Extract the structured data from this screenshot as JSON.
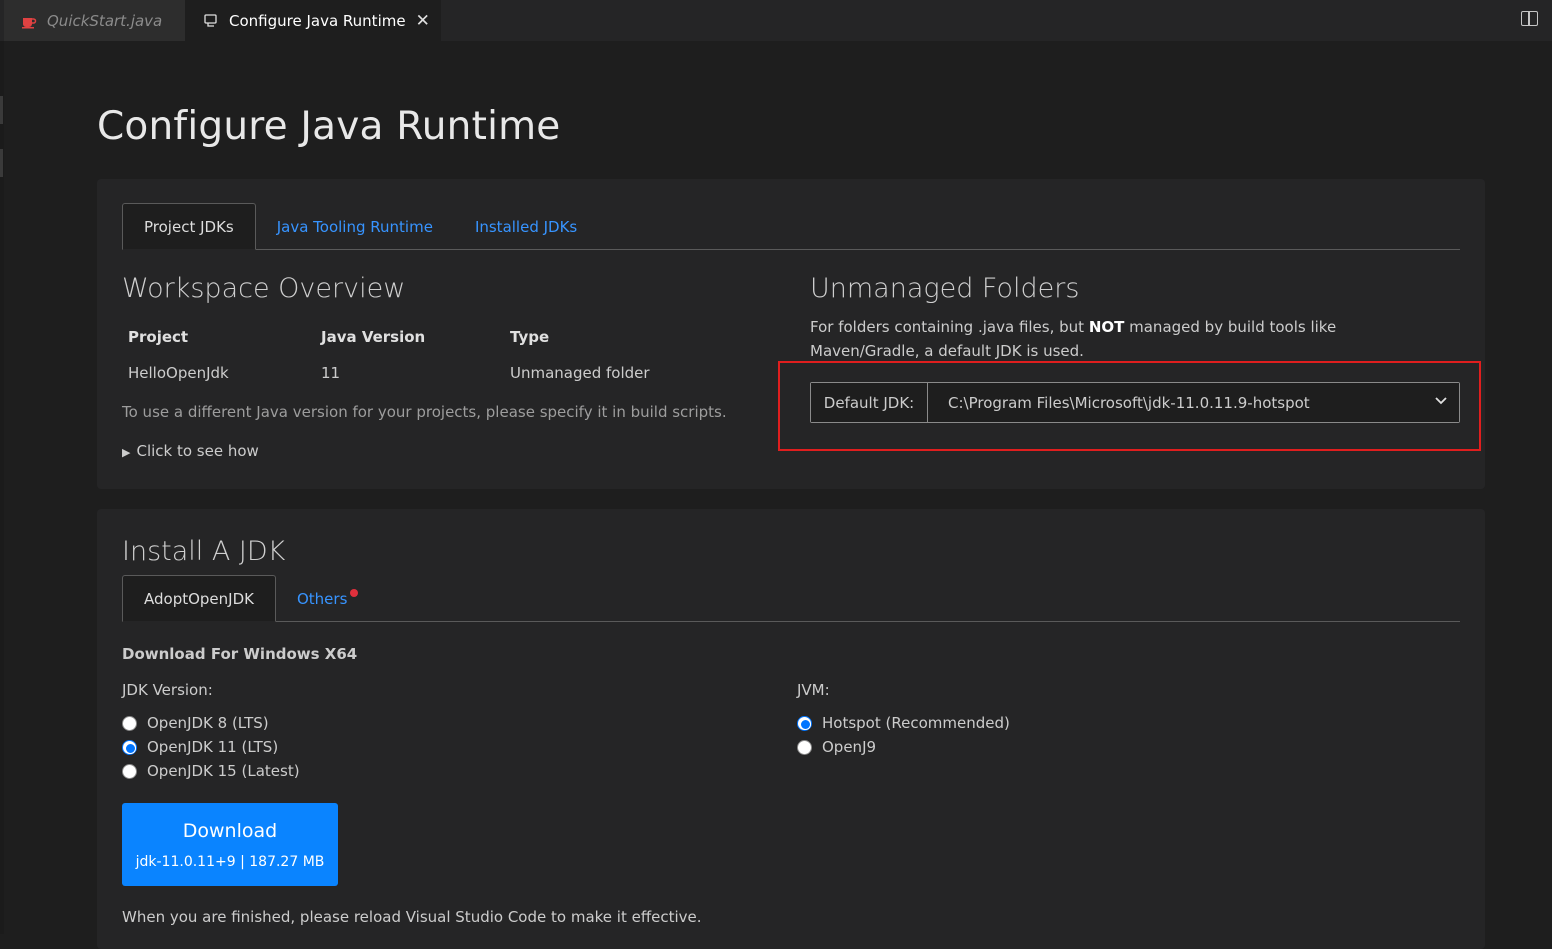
{
  "tabs": [
    {
      "label": "QuickStart.java",
      "icon": "java-cup-icon"
    },
    {
      "label": "Configure Java Runtime",
      "icon": "preview-icon",
      "active": true
    }
  ],
  "page": {
    "title": "Configure Java Runtime"
  },
  "runtime_tabs": [
    "Project JDKs",
    "Java Tooling Runtime",
    "Installed JDKs"
  ],
  "workspace": {
    "title": "Workspace Overview",
    "columns": [
      "Project",
      "Java Version",
      "Type"
    ],
    "rows": [
      [
        "HelloOpenJdk",
        "11",
        "Unmanaged folder"
      ]
    ],
    "hint": "To use a different Java version for your projects, please specify it in build scripts.",
    "details": "Click to see how"
  },
  "unmanaged": {
    "title": "Unmanaged Folders",
    "desc_pre": "For folders containing .java files, but ",
    "desc_bold": "NOT",
    "desc_post": " managed by build tools like Maven/Gradle, a default JDK is used.",
    "label": "Default JDK:",
    "value": "C:\\Program Files\\Microsoft\\jdk-11.0.11.9-hotspot"
  },
  "install": {
    "title": "Install A JDK",
    "tabs": [
      "AdoptOpenJDK",
      "Others"
    ],
    "subhead": "Download For Windows X64",
    "jdk_label": "JDK Version:",
    "jdk_options": [
      "OpenJDK 8 (LTS)",
      "OpenJDK 11 (LTS)",
      "OpenJDK 15 (Latest)"
    ],
    "jdk_selected": 1,
    "jvm_label": "JVM:",
    "jvm_options": [
      "Hotspot (Recommended)",
      "OpenJ9"
    ],
    "jvm_selected": 0,
    "download_label": "Download",
    "download_detail": "jdk-11.0.11+9 | 187.27 MB",
    "finish": "When you are finished, please reload Visual Studio Code to make it effective."
  },
  "colors": {
    "accent": "#0a84ff",
    "link": "#3794ff",
    "highlight": "#e01e1e",
    "badge": "#e0303c"
  }
}
